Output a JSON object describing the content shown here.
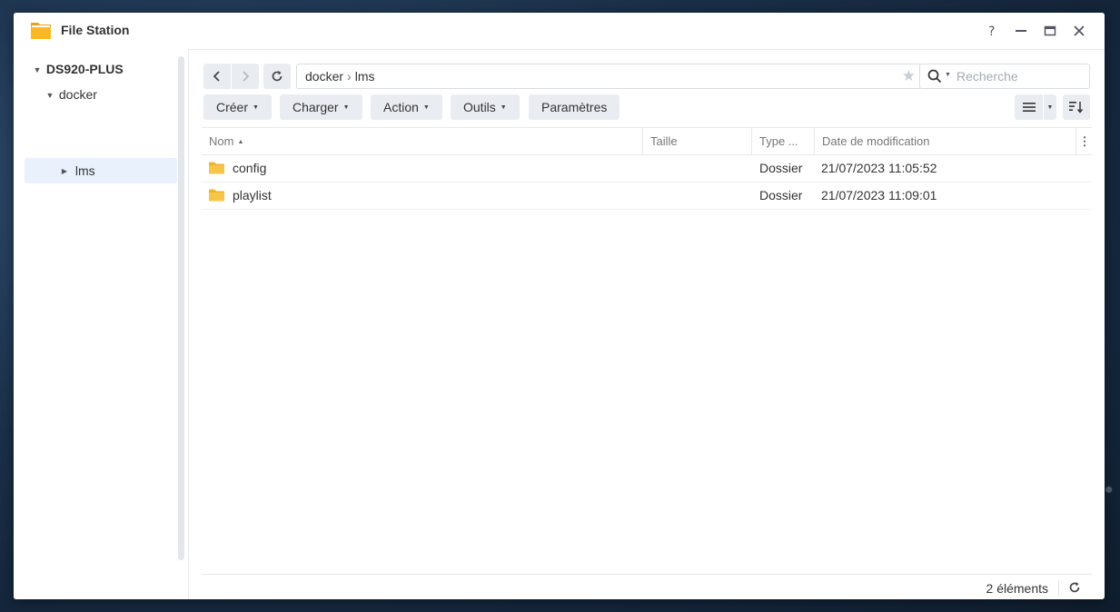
{
  "window": {
    "title": "File Station"
  },
  "sidebar": {
    "host": "DS920-PLUS",
    "items": [
      {
        "label": "docker"
      },
      {
        "label": "lms"
      }
    ]
  },
  "path": {
    "segments": [
      "docker",
      "lms"
    ],
    "separator": "›"
  },
  "search": {
    "placeholder": "Recherche"
  },
  "toolbar": {
    "create": "Créer",
    "upload": "Charger",
    "action": "Action",
    "tools": "Outils",
    "settings": "Paramètres"
  },
  "table": {
    "columns": {
      "name": "Nom",
      "size": "Taille",
      "type": "Type ...",
      "modified": "Date de modification"
    },
    "rows": [
      {
        "name": "config",
        "size": "",
        "type": "Dossier",
        "modified": "21/07/2023 11:05:52"
      },
      {
        "name": "playlist",
        "size": "",
        "type": "Dossier",
        "modified": "21/07/2023 11:09:01"
      }
    ]
  },
  "status": {
    "count": "2 éléments"
  },
  "colors": {
    "accent_selected": "#e8f1fc",
    "folder": "#f7c548",
    "button_bg": "#e9edf2"
  },
  "icons": [
    "file-station-icon",
    "help-icon",
    "minimize-icon",
    "maximize-icon",
    "close-icon",
    "back-icon",
    "forward-icon",
    "refresh-icon",
    "star-icon",
    "search-icon",
    "list-view-icon",
    "sort-icon",
    "folder-icon",
    "more-icon"
  ]
}
